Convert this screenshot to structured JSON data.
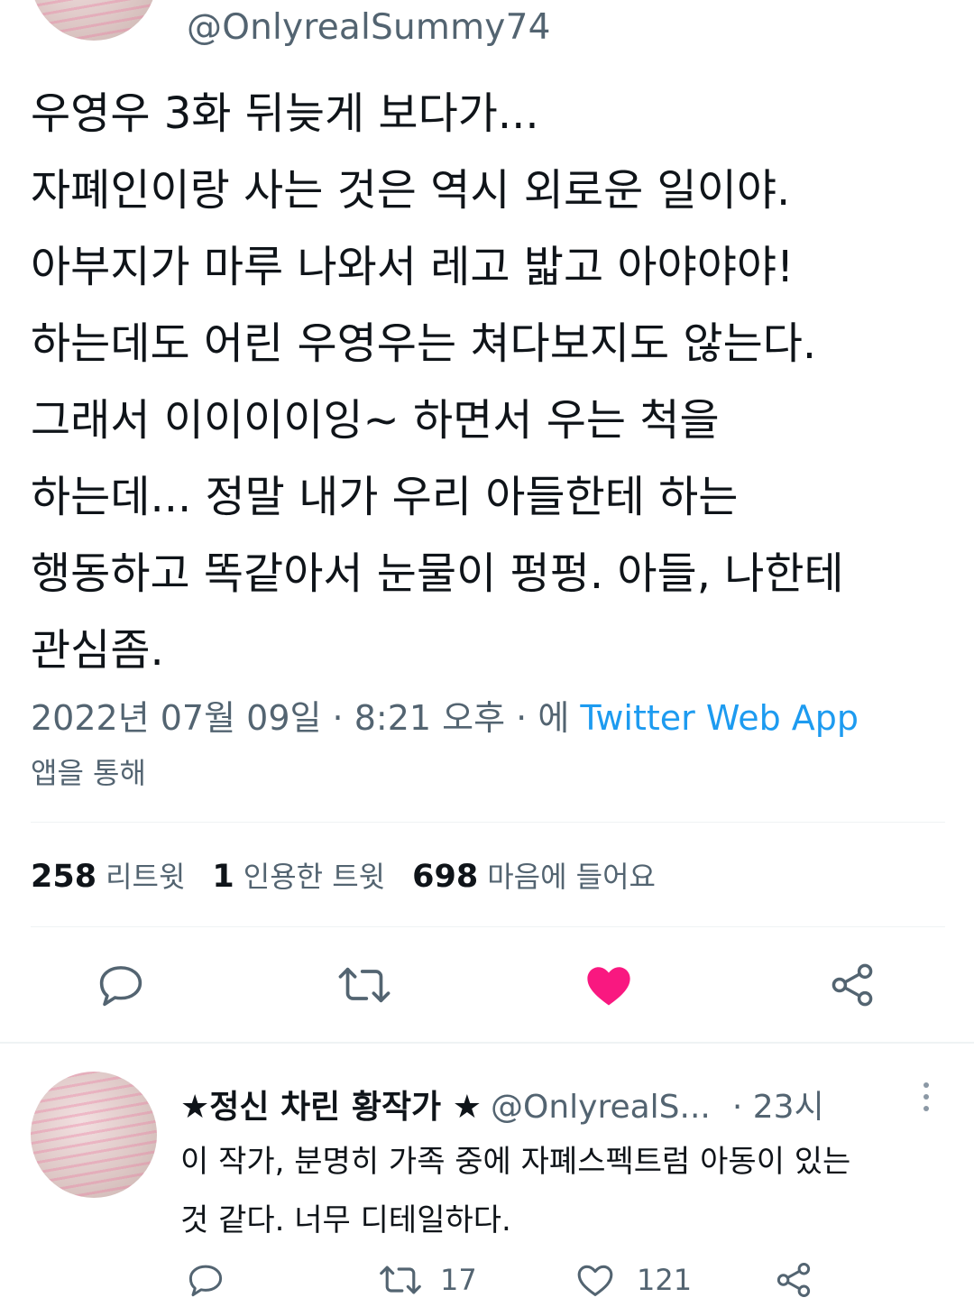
{
  "tweet": {
    "handle": "@OnlyrealSummy74",
    "lines": [
      "우영우 3화 뒤늦게 보다가...",
      "자폐인이랑 사는 것은 역시 외로운 일이야.",
      "아부지가 마루 나와서 레고 밟고 아야야야!",
      "하는데도 어린 우영우는 쳐다보지도 않는다.",
      "그래서 이이이이잉~ 하면서 우는 척을",
      "하는데... 정말 내가 우리 아들한테 하는",
      "행동하고 똑같아서 눈물이 펑펑. 아들, 나한테",
      "관심좀."
    ],
    "date": "2022년 07월 09일",
    "time": "8:21 오후",
    "via_prefix": "에",
    "source_app": "Twitter Web App",
    "via_suffix": "앱을 통해",
    "sep": "·"
  },
  "stats": {
    "retweets_count": "258",
    "retweets_label": "리트윗",
    "quotes_count": "1",
    "quotes_label": "인용한 트윗",
    "likes_count": "698",
    "likes_label": "마음에 들어요"
  },
  "actions": {
    "reply_icon": "reply-icon",
    "retweet_icon": "retweet-icon",
    "like_icon": "heart-filled-icon",
    "share_icon": "share-icon",
    "like_color": "#f91880"
  },
  "reply": {
    "display_name": "★정신 차린 황작가 ★",
    "handle": "@OnlyrealS...",
    "time": "· 23시",
    "lines": [
      "이 작가, 분명히 가족 중에 자폐스펙트럼 아동이 있는",
      "것 같다. 너무 디테일하다."
    ],
    "retweet_count": "17",
    "like_count": "121"
  },
  "colors": {
    "text": "#0f1419",
    "secondary": "#536471",
    "link": "#1d9bf0",
    "divider": "#eff3f4"
  }
}
